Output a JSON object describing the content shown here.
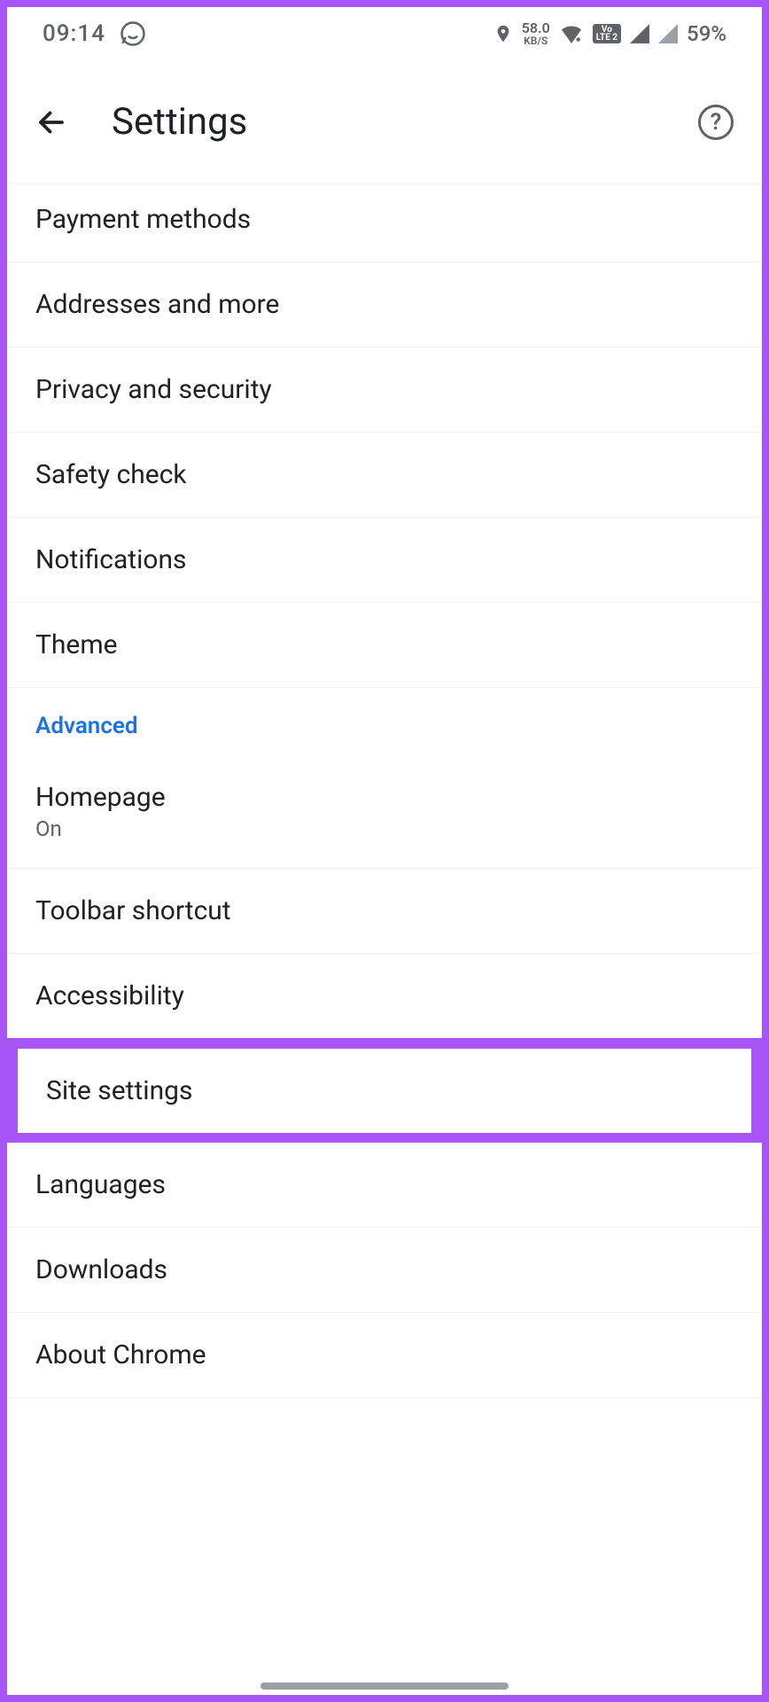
{
  "status_bar": {
    "time": "09:14",
    "network_speed_value": "58.0",
    "network_speed_unit": "KB/S",
    "volte": "VoLTE 2",
    "battery_percent": "59%"
  },
  "app_bar": {
    "title": "Settings"
  },
  "section_header": "Advanced",
  "items": [
    {
      "label": "Payment methods"
    },
    {
      "label": "Addresses and more"
    },
    {
      "label": "Privacy and security"
    },
    {
      "label": "Safety check"
    },
    {
      "label": "Notifications"
    },
    {
      "label": "Theme"
    },
    {
      "label": "Homepage",
      "sublabel": "On"
    },
    {
      "label": "Toolbar shortcut"
    },
    {
      "label": "Accessibility"
    },
    {
      "label": "Site settings"
    },
    {
      "label": "Languages"
    },
    {
      "label": "Downloads"
    },
    {
      "label": "About Chrome"
    }
  ]
}
